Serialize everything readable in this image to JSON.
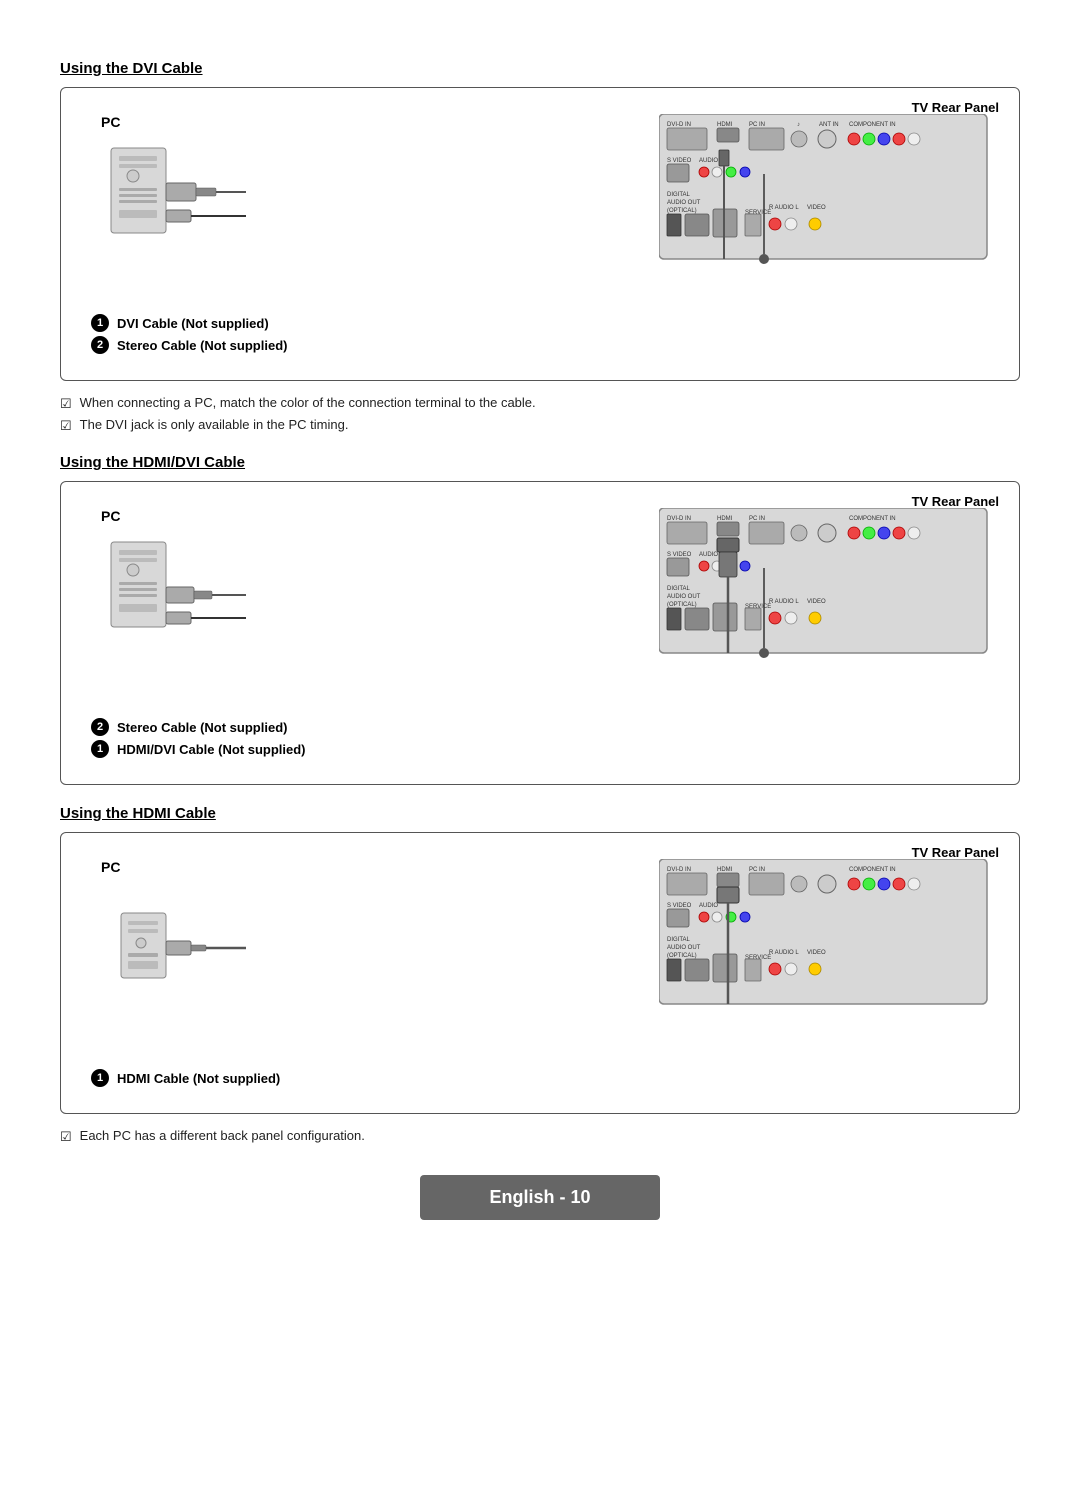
{
  "sections": [
    {
      "id": "dvi",
      "title": "Using the DVI Cable",
      "diagram_label": "TV Rear Panel",
      "pc_label": "PC",
      "cable_labels": [
        {
          "num": "❶",
          "text": "DVI Cable (Not supplied)"
        },
        {
          "num": "❷",
          "text": "Stereo Cable (Not supplied)"
        }
      ],
      "notes": [
        "When connecting a PC, match the color of the connection terminal to the cable.",
        "The DVI jack is only available in the PC timing."
      ]
    },
    {
      "id": "hdmi_dvi",
      "title": "Using the HDMI/DVI Cable",
      "diagram_label": "TV Rear Panel",
      "pc_label": "PC",
      "cable_labels": [
        {
          "num": "❷",
          "text": "Stereo Cable (Not supplied)"
        },
        {
          "num": "❶",
          "text": "HDMI/DVI Cable (Not supplied)"
        }
      ],
      "notes": []
    },
    {
      "id": "hdmi",
      "title": "Using the HDMI Cable",
      "diagram_label": "TV Rear Panel",
      "pc_label": "PC",
      "cable_labels": [
        {
          "num": "❶",
          "text": "HDMI Cable (Not supplied)"
        }
      ],
      "notes": [
        "Each PC has a different back panel configuration."
      ]
    }
  ],
  "footer": {
    "text": "English - 10"
  },
  "note_icon": "☑"
}
